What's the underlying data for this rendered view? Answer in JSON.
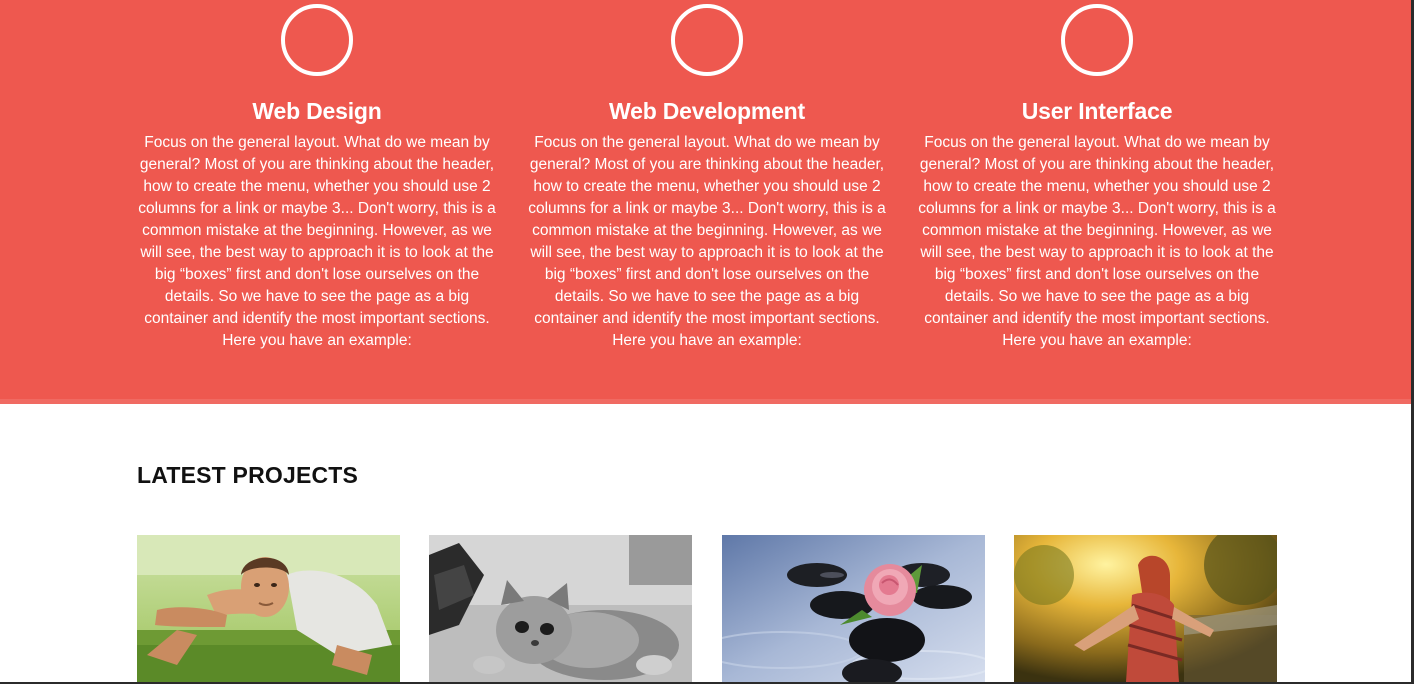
{
  "services": [
    {
      "title": "Web Design",
      "icon": "circle-icon",
      "text": "Focus on the general layout. What do we mean by general? Most of you are thinking about the header, how to create the menu, whether you should use 2 columns for a link or maybe 3... Don't worry, this is a common mistake at the beginning. However, as we will see, the best way to approach it is to look at the big “boxes” first and don't lose ourselves on the details. So we have to see the page as a big container and identify the most important sections. Here you have an example:"
    },
    {
      "title": "Web Development",
      "icon": "circle-icon",
      "text": "Focus on the general layout. What do we mean by general? Most of you are thinking about the header, how to create the menu, whether you should use 2 columns for a link or maybe 3... Don't worry, this is a common mistake at the beginning. However, as we will see, the best way to approach it is to look at the big “boxes” first and don't lose ourselves on the details. So we have to see the page as a big container and identify the most important sections. Here you have an example:"
    },
    {
      "title": "User Interface",
      "icon": "circle-icon",
      "text": "Focus on the general layout. What do we mean by general? Most of you are thinking about the header, how to create the menu, whether you should use 2 columns for a link or maybe 3... Don't worry, this is a common mistake at the beginning. However, as we will see, the best way to approach it is to look at the big “boxes” first and don't lose ourselves on the details. So we have to see the page as a big container and identify the most important sections. Here you have an example:"
    }
  ],
  "projects": {
    "title": "LATEST PROJECTS",
    "items": [
      {
        "image": "man-doing-pushups"
      },
      {
        "image": "kitten-black-and-white"
      },
      {
        "image": "pink-rose-on-stones"
      },
      {
        "image": "woman-in-sunlight"
      }
    ]
  },
  "colors": {
    "accent": "#ee584f",
    "text_light": "#ffffff",
    "heading_dark": "#111111"
  }
}
